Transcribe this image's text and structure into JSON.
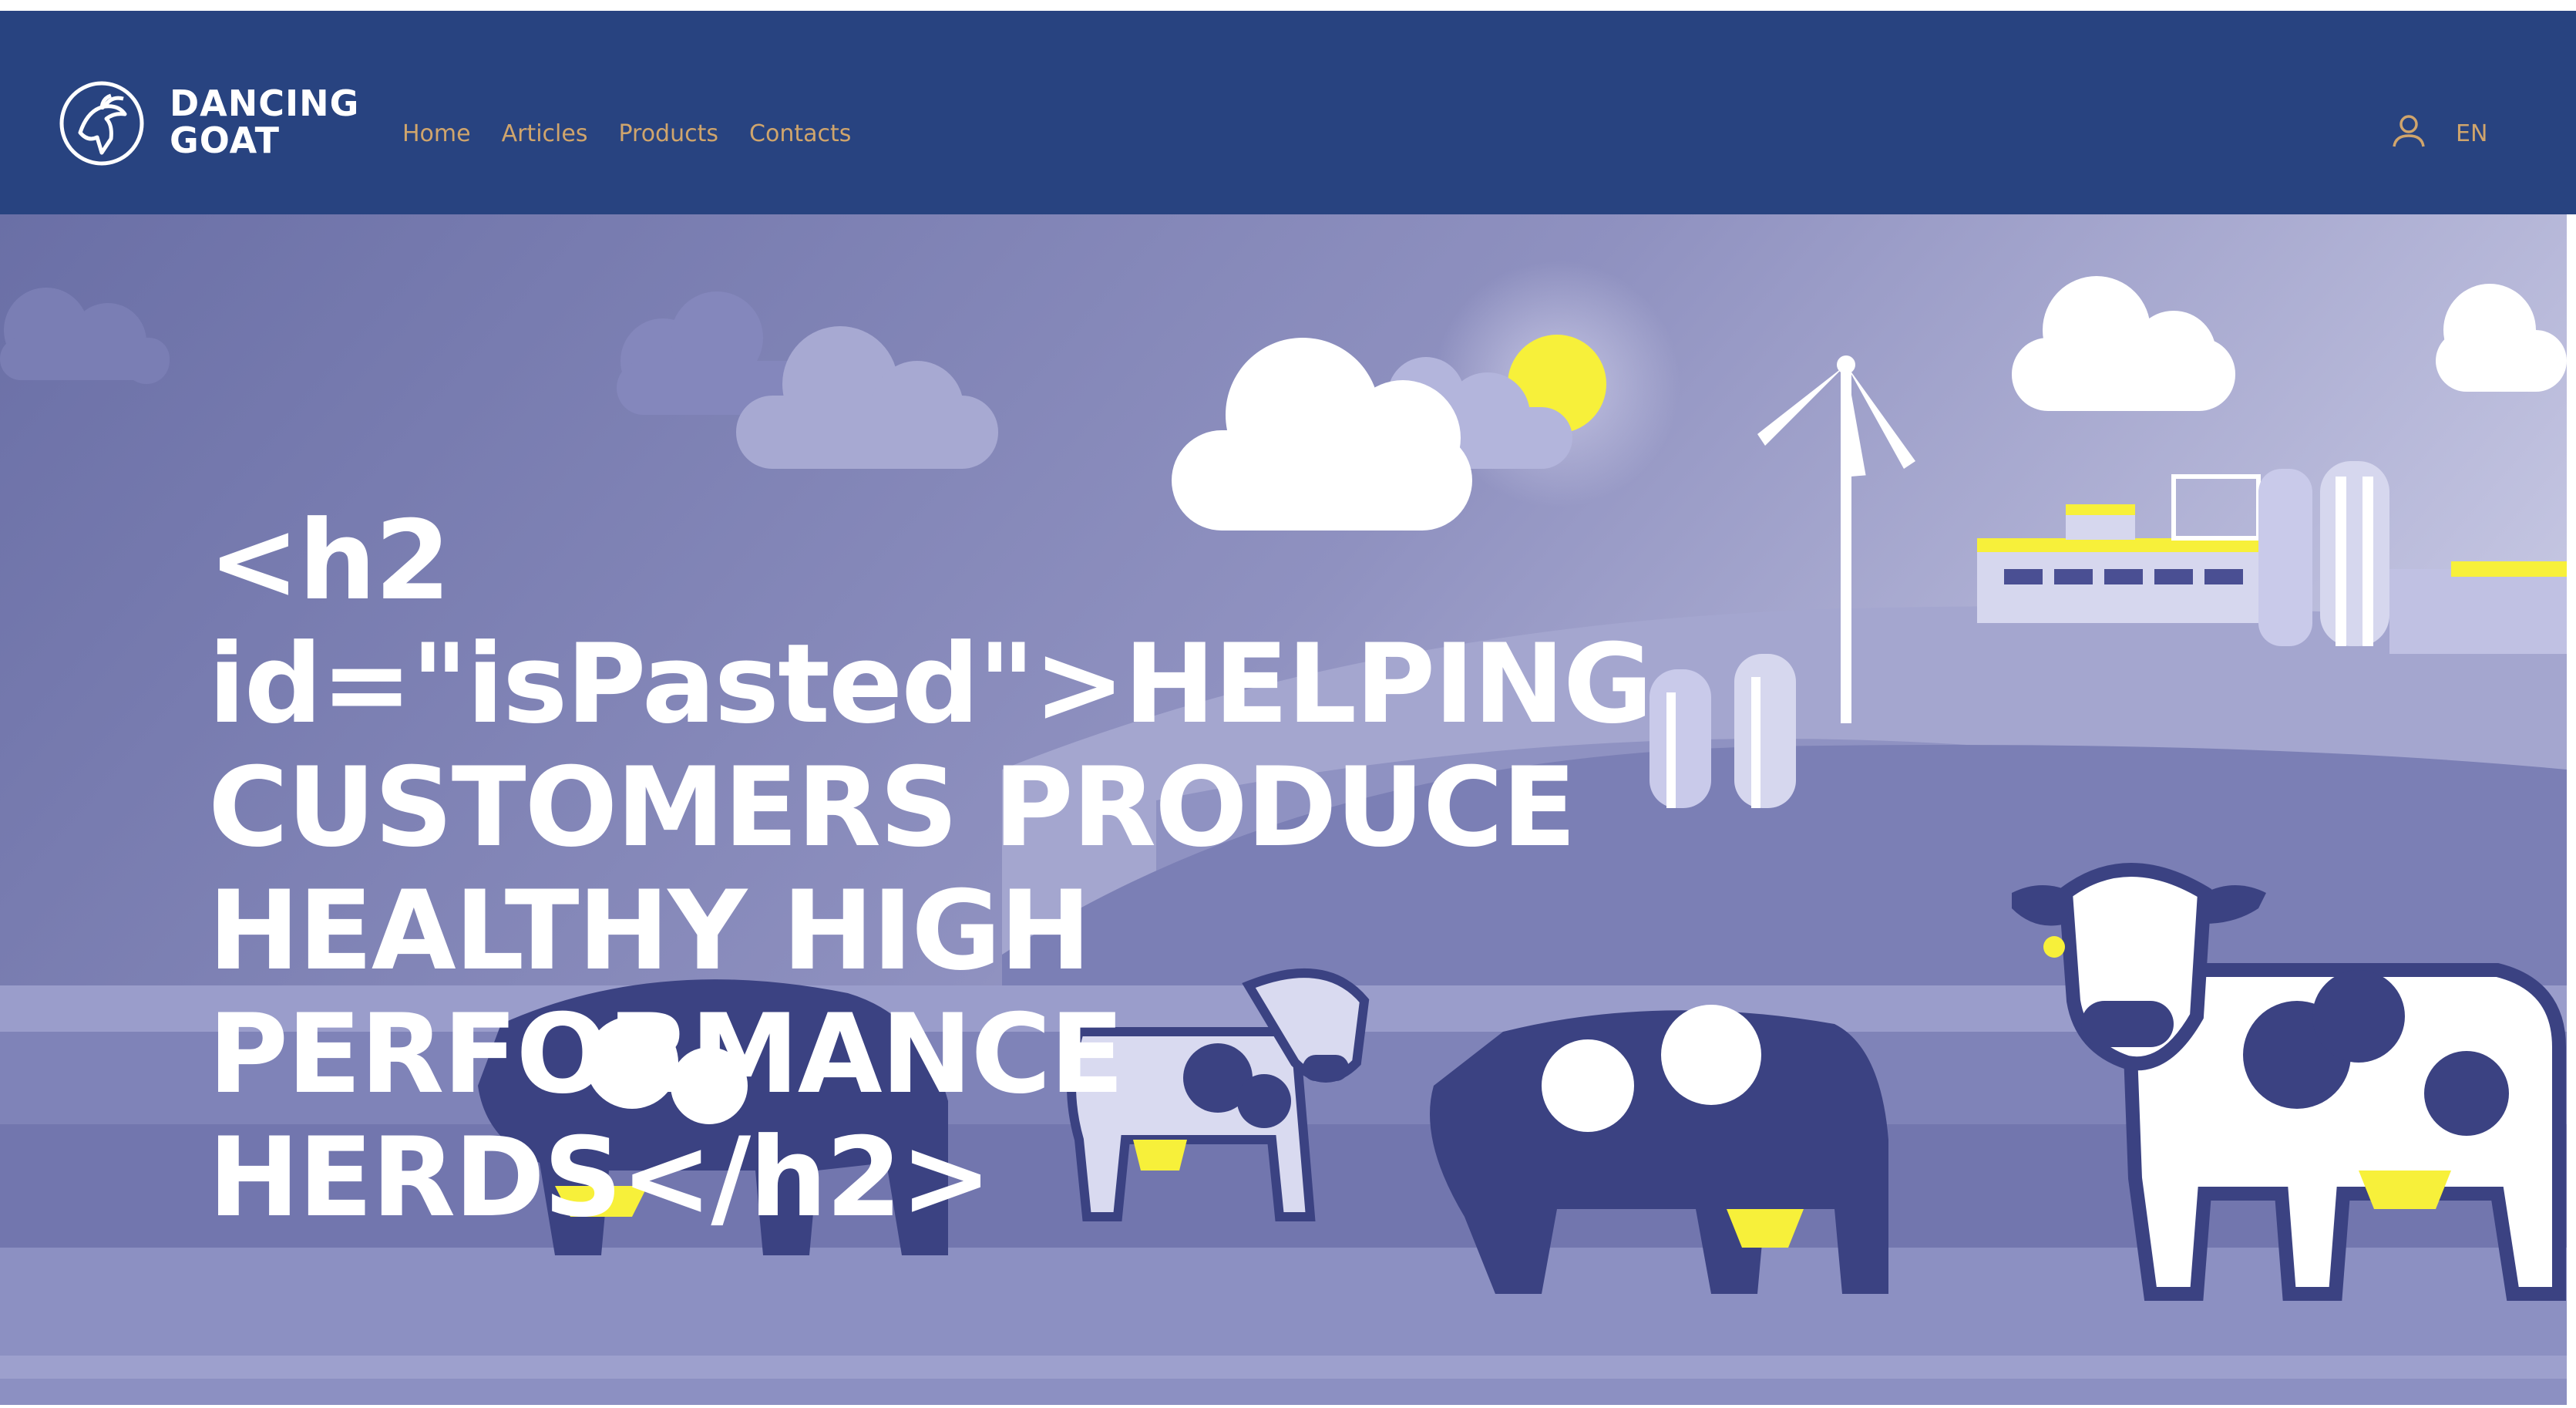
{
  "brand": {
    "line1": "DANCING",
    "line2": "GOAT"
  },
  "nav": {
    "items": [
      "Home",
      "Articles",
      "Products",
      "Contacts"
    ]
  },
  "header": {
    "language": "EN",
    "user_icon": "user-icon"
  },
  "hero": {
    "title": "<h2 id=\"isPasted\">HELPING CUSTOMERS PRODUCE HEALTHY HIGH PERFORMANCE HERDS</h2>",
    "illustration": "farm-illustration"
  },
  "colors": {
    "header_bg": "#284380",
    "nav_link": "#d0a56c",
    "hero_bg": "#8888bb",
    "accent_yellow": "#f7f03a",
    "cow_dark": "#2e3a78"
  }
}
